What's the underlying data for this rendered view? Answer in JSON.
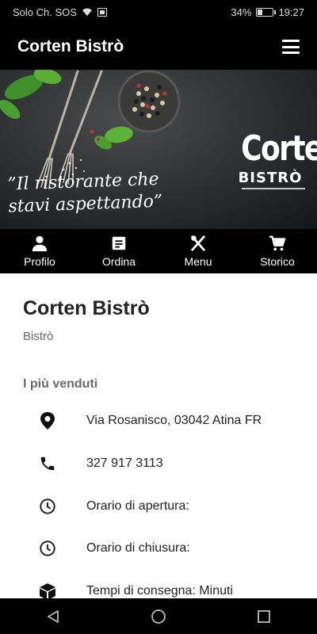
{
  "status_bar": {
    "carrier": "Solo Ch. SOS",
    "battery": "34%",
    "battery_level": 0.34,
    "time": "19:27"
  },
  "app_bar": {
    "title": "Corten Bistrò",
    "menu_icon": "hamburger-menu-icon"
  },
  "hero": {
    "tagline_line1": "”Il ristorante che",
    "tagline_line2": "stavi aspettando”",
    "logo_main": "Corten",
    "logo_sub": "BISTRÒ"
  },
  "tabs": [
    {
      "label": "Profilo",
      "icon": "person-icon"
    },
    {
      "label": "Ordina",
      "icon": "document-icon"
    },
    {
      "label": "Menu",
      "icon": "cutlery-icon"
    },
    {
      "label": "Storico",
      "icon": "cart-icon"
    }
  ],
  "restaurant": {
    "name": "Corten Bistrò",
    "category": "Bistrò"
  },
  "section": {
    "title": "I più venduti"
  },
  "info": [
    {
      "icon": "location-pin-icon",
      "text": "Via Rosanisco, 03042 Atina FR"
    },
    {
      "icon": "phone-icon",
      "text": "327 917 3113"
    },
    {
      "icon": "clock-icon",
      "text": "Orario di apertura:"
    },
    {
      "icon": "clock-icon",
      "text": "Orario di chiusura:"
    },
    {
      "icon": "package-icon",
      "text": "Tempi di consegna: Minuti"
    }
  ],
  "nav": {
    "back_icon": "back-triangle-icon",
    "home_icon": "home-circle-icon",
    "recents_icon": "recents-square-icon"
  }
}
